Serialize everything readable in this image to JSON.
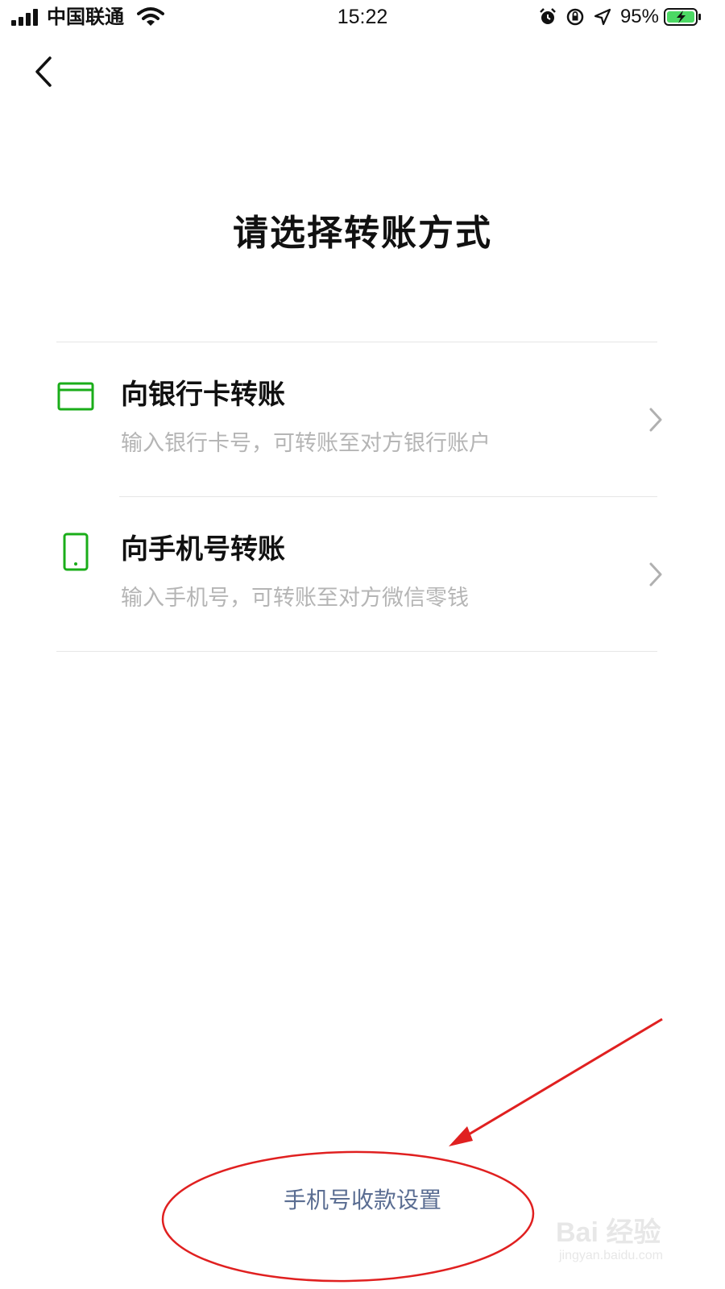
{
  "status_bar": {
    "carrier": "中国联通",
    "time": "15:22",
    "battery_percent": "95%",
    "signal_bars": 4,
    "icons": [
      "signal-icon",
      "wifi-icon",
      "alarm-icon",
      "rotation-lock-icon",
      "location-icon",
      "battery-charging-icon"
    ]
  },
  "nav": {
    "back_icon": "chevron-left-icon"
  },
  "page": {
    "title": "请选择转账方式"
  },
  "options": [
    {
      "title": "向银行卡转账",
      "description": "输入银行卡号，可转账至对方银行账户",
      "icon": "bank-card-icon"
    },
    {
      "title": "向手机号转账",
      "description": "输入手机号，可转账至对方微信零钱",
      "icon": "mobile-phone-icon"
    }
  ],
  "footer": {
    "link_label": "手机号收款设置"
  },
  "watermark": {
    "main": "Bai 经验",
    "sub": "jingyan.baidu.com"
  },
  "colors": {
    "accent_green": "#1aad19",
    "link_blue": "#5a6d92",
    "annotation_red": "#e02020",
    "secondary_text": "#b5b5b5"
  }
}
